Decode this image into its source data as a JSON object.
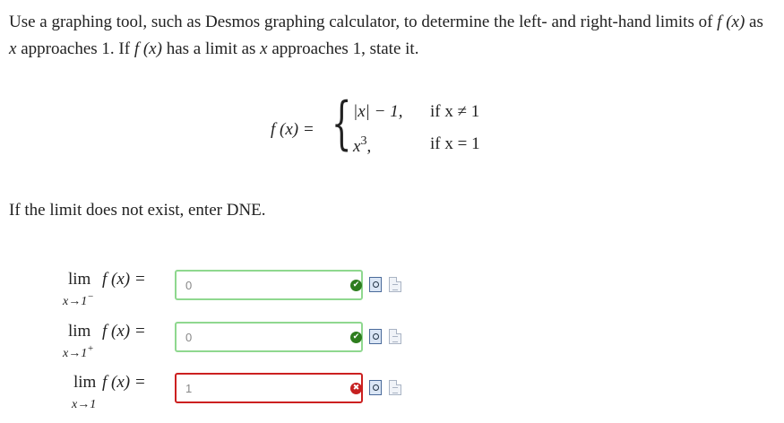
{
  "question": {
    "sentence1_a": "Use a graphing tool, such as Desmos graphing calculator, to determine the left- and right-hand limits of",
    "sentence1_fx": "f (x)",
    "sentence1_b": "as",
    "sentence1_var": "x",
    "sentence1_c": "approaches",
    "sentence1_num": "1.",
    "sentence2_a": "If",
    "sentence2_fx": "f (x)",
    "sentence2_b": "has a limit as",
    "sentence2_var": "x",
    "sentence2_c": "approaches",
    "sentence2_num": "1,",
    "sentence2_d": "state it."
  },
  "piecewise": {
    "lhs": "f (x) =",
    "brace": "{",
    "case1_expr": "|x| − 1,",
    "case1_cond": "if x ≠ 1",
    "case2_base": "x",
    "case2_exp": "3",
    "case2_comma": ",",
    "case2_cond": "if x = 1"
  },
  "instruction": "If the limit does not exist, enter DNE.",
  "limits": [
    {
      "lim": "lim",
      "sub_base": "x→1",
      "sub_side": "−",
      "func": "f (x) =",
      "value": "0",
      "status": "correct",
      "status_glyph": "✔",
      "border_color": "#8fd88f"
    },
    {
      "lim": "lim",
      "sub_base": "x→1",
      "sub_side": "+",
      "func": "f (x) =",
      "value": "0",
      "status": "correct",
      "status_glyph": "✔",
      "border_color": "#8fd88f"
    },
    {
      "lim": "lim",
      "sub_base": "x→1",
      "sub_side": "",
      "func": "f (x) =",
      "value": "1",
      "status": "incorrect",
      "status_glyph": "✖",
      "border_color": "#cc2020"
    }
  ],
  "icons": {
    "preview": "preview-answer-icon",
    "help": "help-document-icon"
  }
}
